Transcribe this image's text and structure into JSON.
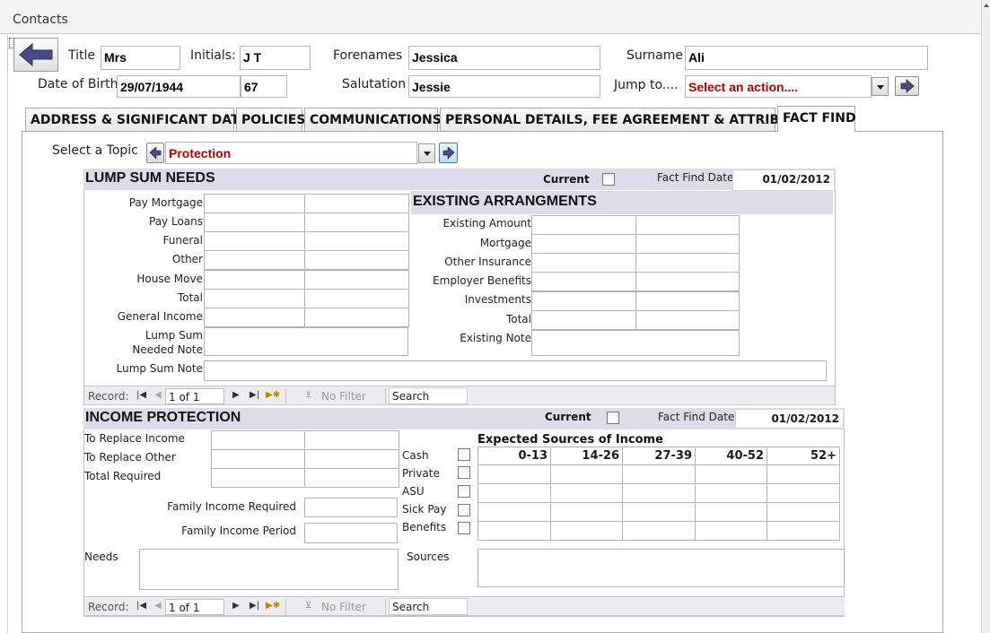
{
  "window": {
    "title": "Contacts"
  },
  "header": {
    "title_label": "Title",
    "title_value": "Mrs",
    "initials_label": "Initials:",
    "initials_value": "J T",
    "forenames_label": "Forenames",
    "forenames_value": "Jessica",
    "surname_label": "Surname",
    "surname_value": "Ali",
    "dob_label": "Date of Birth",
    "dob_value": "29/07/1944",
    "age_value": "67",
    "salutation_label": "Salutation",
    "salutation_value": "Jessie",
    "jump_label": "Jump to....",
    "jump_value": "Select an action...."
  },
  "tabs": [
    {
      "label": "ADDRESS & SIGNIFICANT DATES"
    },
    {
      "label": "POLICIES"
    },
    {
      "label": "COMMUNICATIONS"
    },
    {
      "label": "PERSONAL DETAILS, FEE AGREEMENT & ATTRIBUTES"
    },
    {
      "label": "FACT FIND",
      "active": true
    }
  ],
  "topic": {
    "label": "Select a Topic",
    "value": "Protection"
  },
  "lump_sum": {
    "title": "LUMP SUM NEEDS",
    "current_label": "Current",
    "fact_find_label": "Fact Find Date",
    "fact_find_date": "01/02/2012",
    "rows": [
      "Pay Mortgage",
      "Pay Loans",
      "Funeral",
      "Other",
      "House Move",
      "Total",
      "General Income"
    ],
    "needed_note_label_1": "Lump Sum",
    "needed_note_label_2": "Needed Note",
    "note_label": "Lump Sum Note"
  },
  "existing": {
    "title": "EXISTING ARRANGMENTS",
    "rows": [
      "Existing Amount",
      "Mortgage",
      "Other Insurance",
      "Employer Benefits",
      "Investments",
      "Total"
    ],
    "note_label": "Existing Note"
  },
  "nav1": {
    "record_label": "Record:",
    "record_value": "1 of 1",
    "filter_label": "No Filter",
    "search_label": "Search"
  },
  "income": {
    "title": "INCOME PROTECTION",
    "current_label": "Current",
    "fact_find_label": "Fact Find Date",
    "fact_find_date": "01/02/2012",
    "rows": [
      "To Replace Income",
      "To Replace Other",
      "Total Required"
    ],
    "family_income_required": "Family Income Required",
    "family_income_period": "Family Income Period",
    "sources": [
      "Cash",
      "Private",
      "ASU",
      "Sick Pay",
      "Benefits"
    ],
    "expected_title": "Expected Sources of Income",
    "age_bands": [
      "0-13",
      "14-26",
      "27-39",
      "40-52",
      "52+"
    ],
    "needs_label": "Needs",
    "sources_label": "Sources"
  },
  "nav2": {
    "record_label": "Record:",
    "record_value": "1 of 1",
    "filter_label": "No Filter",
    "search_label": "Search"
  },
  "icons": {
    "back": "back-arrow-icon",
    "go": "arrow-right-icon",
    "prev_topic": "arrow-left-icon",
    "next_topic": "arrow-right-icon",
    "first": "first-record-icon",
    "prev": "prev-record-icon",
    "next": "next-record-icon",
    "last": "last-record-icon",
    "new": "new-record-icon",
    "filter": "filter-icon"
  },
  "colors": {
    "accent_red": "#b40000",
    "section_header": "#dcdceb",
    "nav_bar": "#ececf2"
  }
}
